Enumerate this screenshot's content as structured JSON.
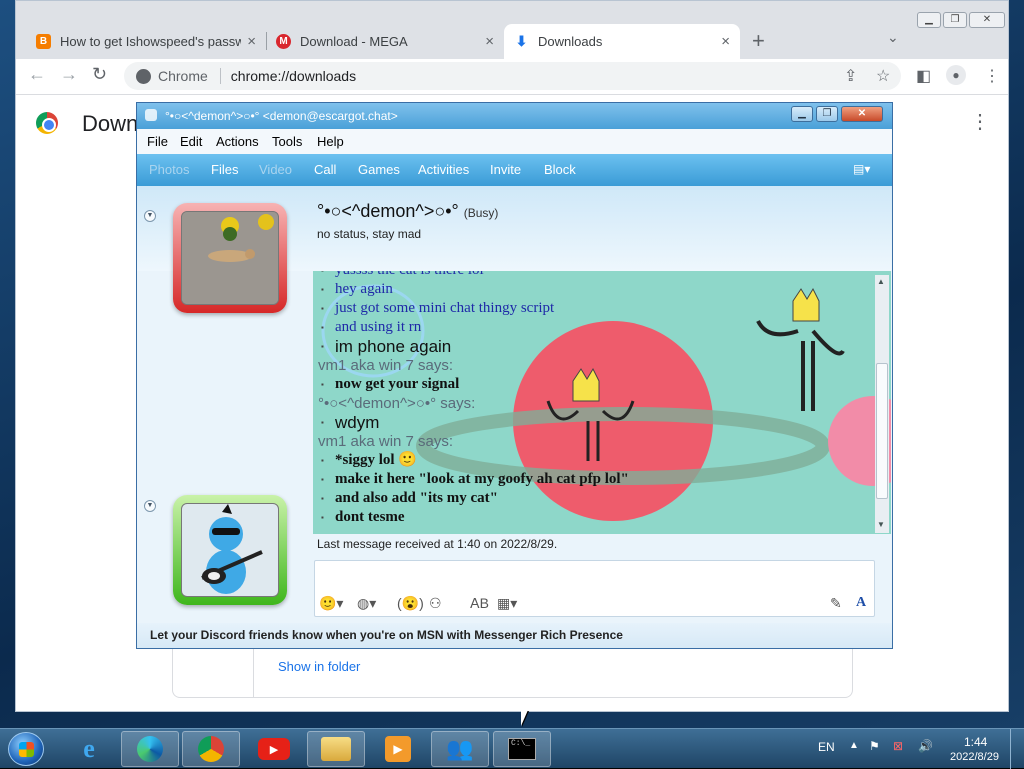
{
  "browser": {
    "tabs": [
      {
        "title": "How to get Ishowspeed's passwo",
        "icon": "blogger-icon",
        "color": "#f57d00"
      },
      {
        "title": "Download - MEGA",
        "icon": "mega-icon",
        "color": "#d9272e"
      },
      {
        "title": "Downloads",
        "icon": "download-icon",
        "color": "#1a73e8"
      }
    ],
    "close_glyph": "×",
    "new_tab_glyph": "+",
    "omnibox_chip": "Chrome",
    "url": "chrome://downloads"
  },
  "downloads_page": {
    "title": "Downloads",
    "show_in_folder": "Show in folder"
  },
  "messenger": {
    "window_title": "°•○<^demon^>○•° <demon@escargot.chat>",
    "menu": [
      "File",
      "Edit",
      "Actions",
      "Tools",
      "Help"
    ],
    "toolbar": [
      {
        "label": "Photos",
        "enabled": false
      },
      {
        "label": "Files",
        "enabled": true
      },
      {
        "label": "Video",
        "enabled": false
      },
      {
        "label": "Call",
        "enabled": true
      },
      {
        "label": "Games",
        "enabled": true
      },
      {
        "label": "Activities",
        "enabled": true
      },
      {
        "label": "Invite",
        "enabled": true
      },
      {
        "label": "Block",
        "enabled": true
      }
    ],
    "contact": {
      "name": "°•○<^demon^>○•°",
      "status": "(Busy)",
      "personal_message": "no status, stay mad"
    },
    "conversation": [
      {
        "type": "line",
        "style": "blue",
        "text": "yussss the cat is there lol"
      },
      {
        "type": "line",
        "style": "blue",
        "text": "hey again"
      },
      {
        "type": "line",
        "style": "blue",
        "text": "just got some mini chat thingy script"
      },
      {
        "type": "line",
        "style": "blue",
        "text": "and using it rn"
      },
      {
        "type": "line",
        "style": "sans",
        "text": "im phone again"
      },
      {
        "type": "sender",
        "text": "vm1 aka win 7 says:"
      },
      {
        "type": "line",
        "style": "bold",
        "text": "now get your signal"
      },
      {
        "type": "sender",
        "text": "°•○<^demon^>○•° says:"
      },
      {
        "type": "line",
        "style": "sans",
        "text": "wdym"
      },
      {
        "type": "sender",
        "text": "vm1 aka win 7 says:"
      },
      {
        "type": "line",
        "style": "bold",
        "text": "*siggy lol 🙂"
      },
      {
        "type": "line",
        "style": "bold",
        "text": "make it here \"look at my goofy ah cat pfp lol\""
      },
      {
        "type": "line",
        "style": "bold",
        "text": "and also add \"its my cat\""
      },
      {
        "type": "line",
        "style": "bold",
        "text": "dont tesme"
      }
    ],
    "last_message": "Last message received at 1:40 on 2022/8/29.",
    "info_bar": "Let your Discord friends know when you're on MSN with Messenger Rich Presence"
  },
  "taskbar": {
    "language": "EN",
    "time": "1:44",
    "date": "2022/8/29"
  }
}
